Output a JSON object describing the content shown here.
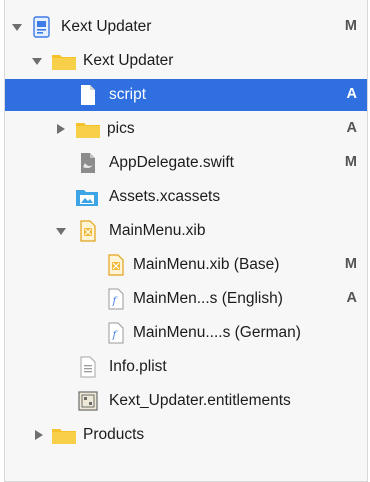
{
  "navigator": {
    "items": [
      {
        "label": "Kext Updater",
        "status": "M",
        "icon": "project-icon"
      },
      {
        "label": "Kext Updater",
        "status": "",
        "icon": "folder-icon"
      },
      {
        "label": "script",
        "status": "A",
        "icon": "file-icon"
      },
      {
        "label": "pics",
        "status": "A",
        "icon": "folder-icon"
      },
      {
        "label": "AppDelegate.swift",
        "status": "M",
        "icon": "swift-file-icon"
      },
      {
        "label": "Assets.xcassets",
        "status": "",
        "icon": "asset-catalog-icon"
      },
      {
        "label": "MainMenu.xib",
        "status": "",
        "icon": "xib-file-icon"
      },
      {
        "label": "MainMenu.xib (Base)",
        "status": "M",
        "icon": "xib-file-icon"
      },
      {
        "label": "MainMen...s (English)",
        "status": "A",
        "icon": "strings-file-icon"
      },
      {
        "label": "MainMenu....s (German)",
        "status": "",
        "icon": "strings-file-icon"
      },
      {
        "label": "Info.plist",
        "status": "",
        "icon": "plist-file-icon"
      },
      {
        "label": "Kext_Updater.entitlements",
        "status": "",
        "icon": "entitlements-file-icon"
      },
      {
        "label": "Products",
        "status": "",
        "icon": "products-folder-icon"
      }
    ],
    "selected_index": 2,
    "colors": {
      "selection": "#2f6fe0",
      "folder": "#f5c12c",
      "background": "#f7f7f7"
    }
  }
}
